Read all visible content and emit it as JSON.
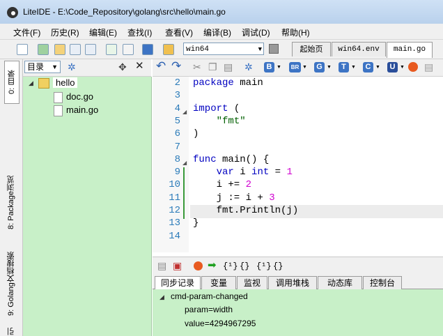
{
  "window": {
    "title": "LiteIDE - E:\\Code_Repository\\golang\\src\\hello\\main.go"
  },
  "menu": [
    "文件(F)",
    "历史(R)",
    "编辑(E)",
    "查找(I)",
    "查看(V)",
    "编译(B)",
    "调试(D)",
    "帮助(H)"
  ],
  "toolbar": {
    "env_select": "win64"
  },
  "tabs": [
    "起始页",
    "win64.env",
    "main.go"
  ],
  "left_strip": {
    "tabs": [
      "0: 目录",
      "8: Package浏览",
      "9: Golang文档搜索",
      "引"
    ]
  },
  "sidebar": {
    "view_select": "目录",
    "tree": [
      {
        "label": "hello",
        "type": "folder"
      },
      {
        "label": "doc.go",
        "type": "file"
      },
      {
        "label": "main.go",
        "type": "file"
      }
    ]
  },
  "editor": {
    "line_numbers": [
      "2",
      "3",
      "4",
      "5",
      "6",
      "7",
      "8",
      "9",
      "10",
      "11",
      "12",
      "13",
      "14"
    ],
    "lines": [
      [
        {
          "t": "package",
          "c": "kw"
        },
        {
          "t": " main",
          "c": ""
        }
      ],
      [],
      [
        {
          "t": "import",
          "c": "kw"
        },
        {
          "t": " (",
          "c": ""
        }
      ],
      [
        {
          "t": "    ",
          "c": ""
        },
        {
          "t": "\"fmt\"",
          "c": "str"
        }
      ],
      [
        {
          "t": ")",
          "c": ""
        }
      ],
      [],
      [
        {
          "t": "func",
          "c": "kw"
        },
        {
          "t": " main() {",
          "c": ""
        }
      ],
      [
        {
          "t": "    ",
          "c": ""
        },
        {
          "t": "var",
          "c": "kw"
        },
        {
          "t": " i ",
          "c": ""
        },
        {
          "t": "int",
          "c": "kw"
        },
        {
          "t": " = ",
          "c": ""
        },
        {
          "t": "1",
          "c": "num"
        }
      ],
      [
        {
          "t": "    i += ",
          "c": ""
        },
        {
          "t": "2",
          "c": "num"
        }
      ],
      [
        {
          "t": "    j := i + ",
          "c": ""
        },
        {
          "t": "3",
          "c": "num"
        }
      ],
      [
        {
          "t": "    fmt.Println(j)",
          "c": ""
        }
      ],
      [
        {
          "t": "}",
          "c": ""
        }
      ],
      []
    ],
    "current_line": "12"
  },
  "bottom_tabs": [
    "同步记录",
    "变量",
    "监视",
    "调用堆栈",
    "动态库",
    "控制台"
  ],
  "bottom_panel": {
    "tree": [
      {
        "label": "cmd-param-changed"
      },
      {
        "label": "param=width"
      },
      {
        "label": "value=4294967295"
      }
    ]
  },
  "bottom_toolbar": {
    "step_icons": [
      "{¹}",
      "{}",
      "{¹}",
      "{}"
    ]
  }
}
